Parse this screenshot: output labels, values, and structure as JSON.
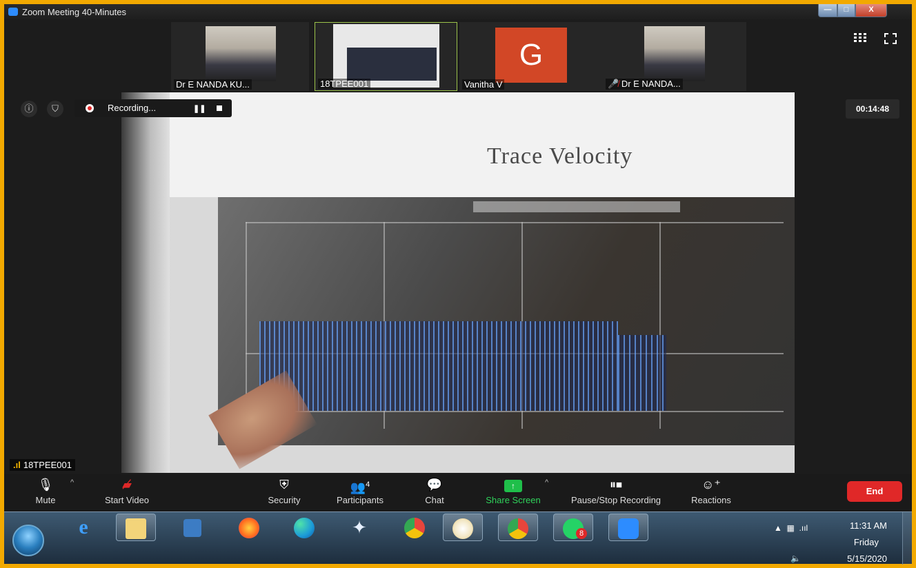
{
  "window": {
    "title": "Zoom Meeting 40-Minutes",
    "minimize": "—",
    "maximize": "□",
    "close": "X"
  },
  "participants_strip": [
    {
      "name": "Dr E NANDA KU..."
    },
    {
      "name": "18TPEE001"
    },
    {
      "name": "Vanitha V",
      "avatar_letter": "G",
      "avatar_color": "#d24726"
    },
    {
      "name": "Dr E NANDA...",
      "muted": true
    }
  ],
  "recording": {
    "label": "Recording...",
    "pause_glyph": "❚❚"
  },
  "timer": "00:14:48",
  "main_video": {
    "slide_title": "Trace Velocity"
  },
  "speaker": {
    "name": "18TPEE001"
  },
  "toolbar": {
    "mute": "Mute",
    "start_video": "Start Video",
    "security": "Security",
    "participants": "Participants",
    "participants_count": "4",
    "chat": "Chat",
    "share_screen": "Share Screen",
    "pause_stop_recording": "Pause/Stop Recording",
    "reactions": "Reactions",
    "end": "End"
  },
  "taskbar": {
    "apps": [
      {
        "name": "internet-explorer",
        "glyph": "e"
      },
      {
        "name": "file-explorer",
        "glyph": "🗂"
      },
      {
        "name": "media-player",
        "glyph": "▶"
      },
      {
        "name": "firefox",
        "glyph": "●"
      },
      {
        "name": "edge",
        "glyph": "e"
      },
      {
        "name": "dropbox",
        "glyph": "✦"
      },
      {
        "name": "chrome",
        "glyph": "●"
      },
      {
        "name": "paint",
        "glyph": "🎨"
      },
      {
        "name": "chrome-profile",
        "glyph": "●"
      },
      {
        "name": "whatsapp",
        "glyph": "✆",
        "badge": "8"
      },
      {
        "name": "zoom",
        "glyph": "▮"
      }
    ],
    "clock": {
      "time": "11:31 AM",
      "day": "Friday",
      "date": "5/15/2020"
    }
  },
  "colors": {
    "border": "#f2a900",
    "end_button": "#e02828",
    "share_green": "#1fbf4a",
    "zoom_blue": "#2d8cff"
  }
}
